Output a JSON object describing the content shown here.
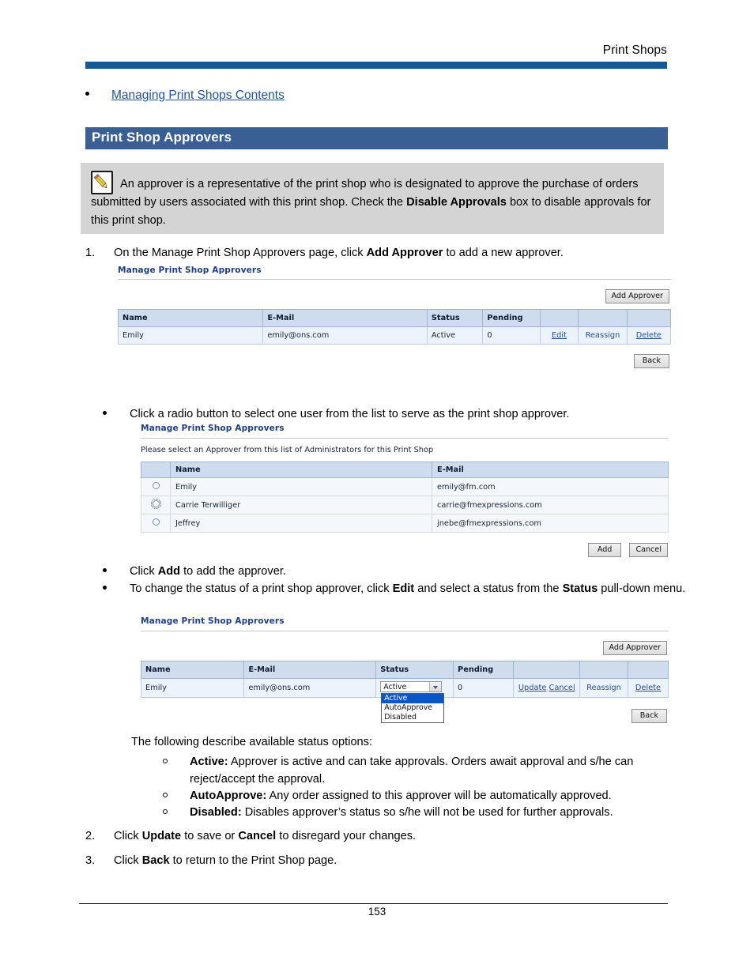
{
  "header": {
    "running_title": "Print Shops"
  },
  "toc": {
    "link": "Managing Print Shops Contents"
  },
  "section": {
    "title": "Print Shop Approvers"
  },
  "note": {
    "icon": "pencil-note-icon",
    "text_part1": "An approver is a representative of the print shop who is designated to approve the purchase of orders submitted by users associated with this print shop. Check the ",
    "bold_term": "Disable Approvals",
    "text_part2": " box to disable approvals for this print shop."
  },
  "steps": {
    "step1_marker": "1.",
    "step1_a": "On the Manage Print Shop Approvers page, click ",
    "step1_bold": "Add Approver",
    "step1_b": " to add a new approver.",
    "bullet_radio": "Click a radio button to select one user from the list to serve as the print shop approver.",
    "bullet_add_a": "Click ",
    "bullet_add_bold": "Add",
    "bullet_add_b": " to add the approver.",
    "bullet_status_a": "To change the status of a print shop approver, click ",
    "bullet_status_bold1": "Edit",
    "bullet_status_b": " and select a status from the ",
    "bullet_status_bold2": "Status",
    "bullet_status_c": " pull-down menu.",
    "status_intro": "The following describe available status options:",
    "opt_active_bold": "Active:",
    "opt_active_text": " Approver is active and can take approvals. Orders await approval and s/he can reject/accept the approval.",
    "opt_autoapprove_bold": "AutoApprove:",
    "opt_autoapprove_text": " Any order assigned to this approver will be automatically approved.",
    "opt_disabled_bold": "Disabled:",
    "opt_disabled_text": " Disables approver’s status so s/he will not be used for further approvals.",
    "step2_marker": "2.",
    "step2_a": "Click ",
    "step2_bold1": "Update",
    "step2_b": " to save or ",
    "step2_bold2": "Cancel",
    "step2_c": " to disregard your changes.",
    "step3_marker": "3.",
    "step3_a": "Click ",
    "step3_bold": "Back",
    "step3_b": " to return to the Print Shop page."
  },
  "screenshot1": {
    "title": "Manage Print Shop Approvers",
    "add_approver_button": "Add Approver",
    "back_button": "Back",
    "columns": [
      "Name",
      "E-Mail",
      "Status",
      "Pending",
      "",
      "",
      ""
    ],
    "rows": [
      {
        "name": "Emily",
        "email": "emily@ons.com",
        "status": "Active",
        "pending": "0",
        "action_edit": "Edit",
        "action_reassign": "Reassign",
        "action_delete": "Delete"
      }
    ]
  },
  "screenshot2": {
    "title": "Manage Print Shop Approvers",
    "instruction": "Please select an Approver from this list of Administrators for this Print Shop",
    "columns": [
      "",
      "Name",
      "E-Mail"
    ],
    "rows": [
      {
        "selected": "false",
        "focused": "false",
        "name": "Emily",
        "email": "emily@fm.com"
      },
      {
        "selected": "false",
        "focused": "true",
        "name": "Carrie Terwilliger",
        "email": "carrie@fmexpressions.com"
      },
      {
        "selected": "false",
        "focused": "false",
        "name": "Jeffrey",
        "email": "jnebe@fmexpressions.com"
      }
    ],
    "add_button": "Add",
    "cancel_button": "Cancel"
  },
  "screenshot3": {
    "title": "Manage Print Shop Approvers",
    "add_approver_button": "Add Approver",
    "back_button": "Back",
    "columns": [
      "Name",
      "E-Mail",
      "Status",
      "Pending",
      "",
      "",
      ""
    ],
    "rows": [
      {
        "name": "Emily",
        "email": "emily@ons.com",
        "status_value": "Active",
        "pending": "0",
        "action_update": "Update",
        "action_cancel": "Cancel",
        "action_reassign": "Reassign",
        "action_delete": "Delete"
      }
    ],
    "status_options": [
      "Active",
      "AutoApprove",
      "Disabled"
    ],
    "status_selected": "Active"
  },
  "footer": {
    "page_number": "153"
  },
  "colors": {
    "rule_blue": "#16588f",
    "band_blue": "#3a5f94",
    "link_blue": "#1f52a0",
    "note_gray": "#d4d4d4",
    "app_title_blue": "#1f3f86",
    "table_header_blue": "#cfdcee",
    "dropdown_highlight": "#0a56c8"
  }
}
